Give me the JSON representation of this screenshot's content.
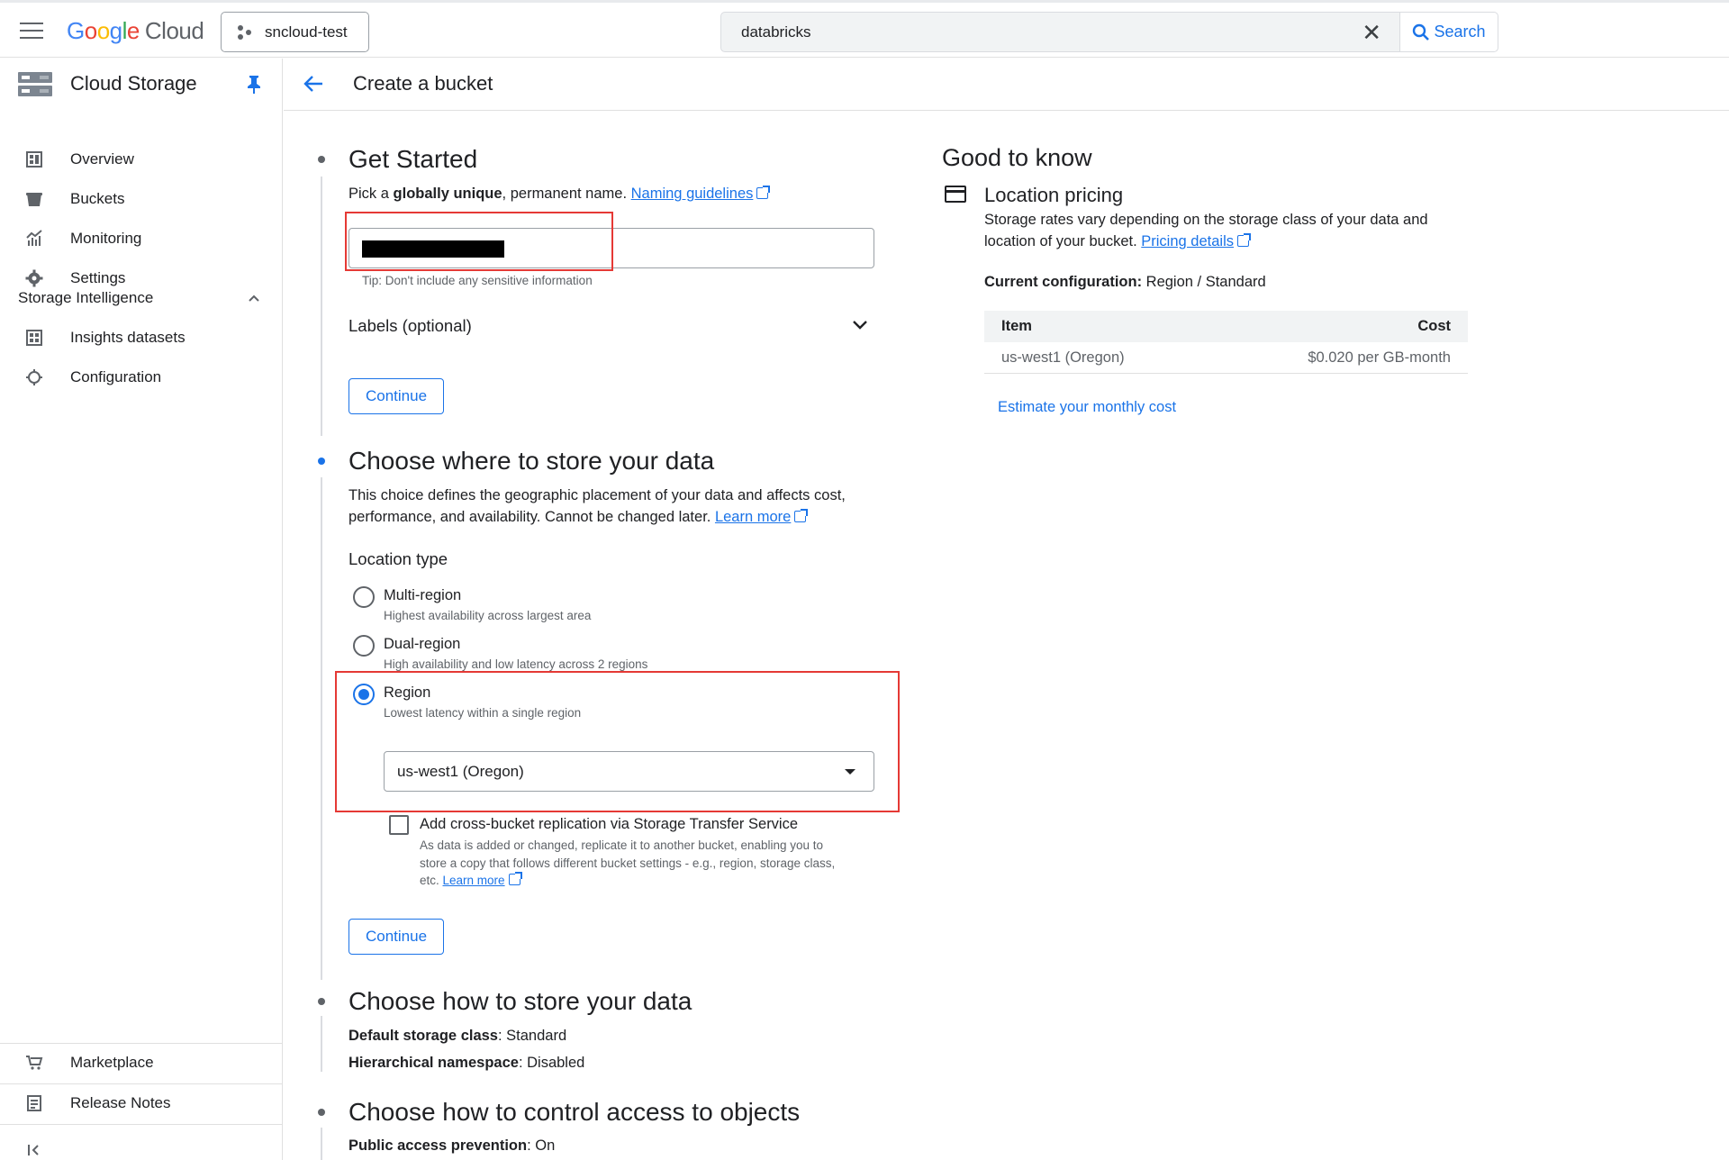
{
  "topbar": {
    "logo_word": [
      "G",
      "o",
      "o",
      "g",
      "l",
      "e"
    ],
    "logo_suffix": "Cloud",
    "project": "sncloud-test",
    "search_value": "databricks",
    "search_button": "Search"
  },
  "sidebar": {
    "product": "Cloud Storage",
    "items": [
      {
        "label": "Overview",
        "icon": "overview-icon"
      },
      {
        "label": "Buckets",
        "icon": "bucket-icon"
      },
      {
        "label": "Monitoring",
        "icon": "monitoring-icon"
      },
      {
        "label": "Settings",
        "icon": "gear-icon"
      }
    ],
    "section": "Storage Intelligence",
    "section_items": [
      {
        "label": "Insights datasets",
        "icon": "dataset-icon"
      },
      {
        "label": "Configuration",
        "icon": "configuration-icon"
      }
    ],
    "footer_items": [
      {
        "label": "Marketplace",
        "icon": "marketplace-icon"
      },
      {
        "label": "Release Notes",
        "icon": "release-notes-icon"
      }
    ]
  },
  "page": {
    "title": "Create a bucket"
  },
  "get_started": {
    "heading": "Get Started",
    "intro_pre": "Pick a ",
    "intro_bold": "globally unique",
    "intro_post": ", permanent name. ",
    "naming_link": "Naming guidelines",
    "tip": "Tip: Don't include any sensitive information",
    "labels": "Labels (optional)",
    "continue": "Continue"
  },
  "location": {
    "heading": "Choose where to store your data",
    "desc_line1": "This choice defines the geographic placement of your data and affects cost,",
    "desc_line2": "performance, and availability. Cannot be changed later. ",
    "learn_more": "Learn more",
    "type_label": "Location type",
    "options": [
      {
        "label": "Multi-region",
        "desc": "Highest availability across largest area",
        "selected": false
      },
      {
        "label": "Dual-region",
        "desc": "High availability and low latency across 2 regions",
        "selected": false
      },
      {
        "label": "Region",
        "desc": "Lowest latency within a single region",
        "selected": true
      }
    ],
    "region_value": "us-west1 (Oregon)",
    "replication_label": "Add cross-bucket replication via Storage Transfer Service",
    "replication_desc1": "As data is added or changed, replicate it to another bucket, enabling you to",
    "replication_desc2": "store a copy that follows different bucket settings - e.g., region, storage class,",
    "replication_desc3": "etc. ",
    "replication_learn_more": "Learn more",
    "replication_checked": false,
    "continue": "Continue"
  },
  "storage": {
    "heading": "Choose how to store your data",
    "class_label": "Default storage class",
    "class_value": ": Standard",
    "hns_label": "Hierarchical namespace",
    "hns_value": ": Disabled"
  },
  "access": {
    "heading": "Choose how to control access to objects",
    "pap_label": "Public access prevention",
    "pap_value": ": On"
  },
  "good_to_know": {
    "heading": "Good to know",
    "pricing_title": "Location pricing",
    "pricing_desc1": "Storage rates vary depending on the storage class of your data and",
    "pricing_desc2": "location of your bucket. ",
    "pricing_link": "Pricing details",
    "config_label": "Current configuration:",
    "config_value": " Region / Standard",
    "table_headers": [
      "Item",
      "Cost"
    ],
    "table_rows": [
      [
        "us-west1 (Oregon)",
        "$0.020 per GB-month"
      ]
    ],
    "estimate_link": "Estimate your monthly cost"
  }
}
